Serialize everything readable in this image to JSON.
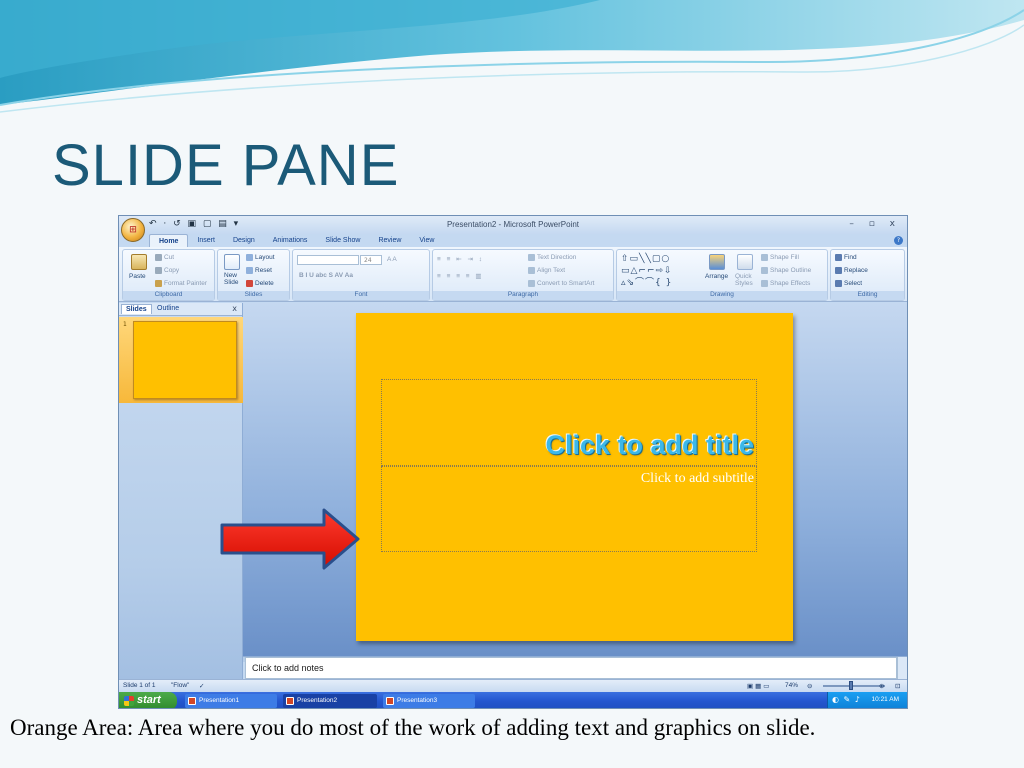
{
  "slide": {
    "heading": "SLIDE PANE",
    "caption": "Orange Area:  Area where you do most of the work of adding text and graphics on slide."
  },
  "window": {
    "office_button": "⊞",
    "qat": "↶ · ↺ ▣ ▢ ▤ ▾",
    "title": "Presentation2 - Microsoft PowerPoint",
    "controls": "– ▫ x",
    "help": "?"
  },
  "ribbon": {
    "tabs": [
      "Home",
      "Insert",
      "Design",
      "Animations",
      "Slide Show",
      "Review",
      "View"
    ],
    "active_tab": "Home",
    "clipboard": {
      "label": "Clipboard",
      "paste": "Paste",
      "cut": "Cut",
      "copy": "Copy",
      "format_painter": "Format Painter"
    },
    "slides": {
      "label": "Slides",
      "new_slide_1": "New",
      "new_slide_2": "Slide",
      "layout": "Layout",
      "reset": "Reset",
      "delete": "Delete"
    },
    "font": {
      "label": "Font",
      "font_name": "",
      "font_size": "24",
      "buttons": "B  I  U  abc  S  AV  Aa",
      "grow_shrink": "A  A"
    },
    "paragraph": {
      "label": "Paragraph",
      "text_direction": "Text Direction",
      "align_text": "Align Text",
      "convert_smartart": "Convert to SmartArt"
    },
    "drawing": {
      "label": "Drawing",
      "arrange": "Arrange",
      "quick_styles_1": "Quick",
      "quick_styles_2": "Styles",
      "shape_fill": "Shape Fill",
      "shape_outline": "Shape Outline",
      "shape_effects": "Shape Effects",
      "shapes_row1": "⇧▭╲╲▢○",
      "shapes_row2": "▭△⌐⌐⇨⇩",
      "shapes_row3": "▵⇘⌒⌒{ }"
    },
    "editing": {
      "label": "Editing",
      "find": "Find",
      "replace": "Replace",
      "select": "Select"
    }
  },
  "left_pane": {
    "tab_slides": "Slides",
    "tab_outline": "Outline",
    "close": "x",
    "slide_number": "1"
  },
  "editor": {
    "title_placeholder": "Click to add title",
    "subtitle_placeholder": "Click to add subtitle",
    "notes_placeholder": "Click to add notes",
    "slide_color": "#ffc000"
  },
  "status": {
    "slide_counter": "Slide 1 of 1",
    "theme": "\"Flow\"",
    "zoom": "74%",
    "zoom_level": 0.45
  },
  "taskbar": {
    "start": "start",
    "tasks": [
      "Presentation1",
      "Presentation2",
      "Presentation3"
    ],
    "active_task": "Presentation2",
    "clock": "10:21 AM",
    "tray": "◐ ✎ ♪"
  }
}
